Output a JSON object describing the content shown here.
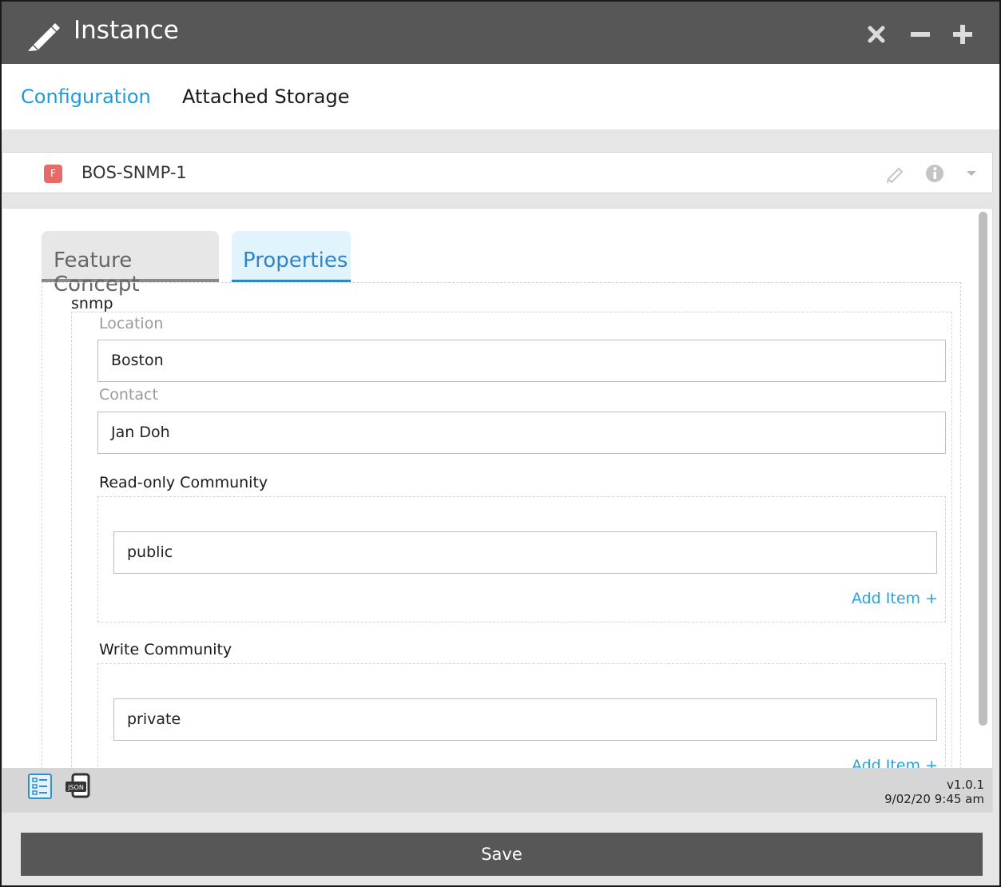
{
  "window": {
    "title": "Instance",
    "controls": [
      "close-icon",
      "minimize-icon",
      "maximize-icon"
    ]
  },
  "top_tabs": [
    {
      "label": "Configuration",
      "active": true
    },
    {
      "label": "Attached Storage",
      "active": false
    }
  ],
  "instance": {
    "badge": "F",
    "name": "BOS-SNMP-1",
    "icons": [
      "pencil-icon",
      "info-icon",
      "caret-down-icon"
    ]
  },
  "sub_tabs": [
    {
      "label": "Feature Concept",
      "active": false
    },
    {
      "label": "Properties",
      "active": true
    }
  ],
  "form": {
    "section": "snmp",
    "location": {
      "label": "Location",
      "value": "Boston"
    },
    "contact": {
      "label": "Contact",
      "value": "Jan Doh"
    },
    "read_only_community": {
      "title": "Read-only Community",
      "items": [
        "public"
      ],
      "add_label": "Add Item +"
    },
    "write_community": {
      "title": "Write Community",
      "items": [
        "private"
      ],
      "add_label": "Add Item +"
    }
  },
  "footer": {
    "version": "v1.0.1",
    "timestamp": "9/02/20 9:45 am",
    "icons": [
      "form-view-icon",
      "json-view-icon"
    ]
  },
  "save_label": "Save",
  "colors": {
    "titlebar": "#575757",
    "accent": "#1e9bd7",
    "badge": "#e96868",
    "background": "#e6e6e6"
  }
}
